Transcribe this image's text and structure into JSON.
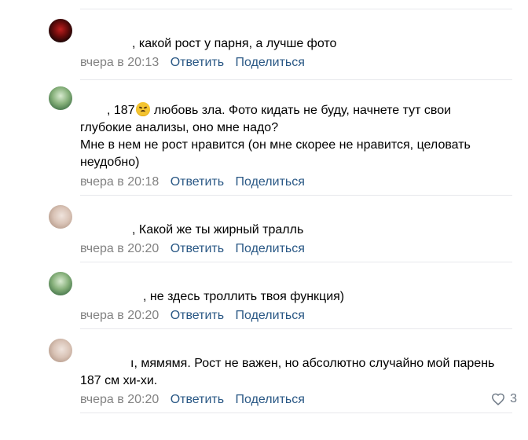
{
  "comments": [
    {
      "name_gap": "",
      "text": ", какой рост у парня, а лучше фото",
      "time": "вчера в 20:13",
      "reply": "Ответить",
      "share": "Поделиться"
    },
    {
      "text_part1": ", 187",
      "emoji": "disappointed-face",
      "text_part2": " любовь зла. Фото кидать не буду, начнете тут свои глубокие анализы, оно мне надо?",
      "text_line2": "Мне в нем не рост нравится (он мне скорее не нравится, целовать неудобно)",
      "time": "вчера в 20:18",
      "reply": "Ответить",
      "share": "Поделиться"
    },
    {
      "text": ", Какой же ты жирный тралль",
      "time": "вчера в 20:20",
      "reply": "Ответить",
      "share": "Поделиться"
    },
    {
      "text": ", не здесь троллить твоя функция)",
      "time": "вчера в 20:20",
      "reply": "Ответить",
      "share": "Поделиться"
    },
    {
      "text": "ı, мямямя. Рост не важен, но абсолютно случайно мой парень 187 см хи-хи.",
      "time": "вчера в 20:20",
      "reply": "Ответить",
      "share": "Поделиться",
      "likes": "3"
    }
  ],
  "colors": {
    "link": "#2a5885",
    "meta": "#828282",
    "divider": "#e7e8ec",
    "like_icon": "#6d7885"
  }
}
